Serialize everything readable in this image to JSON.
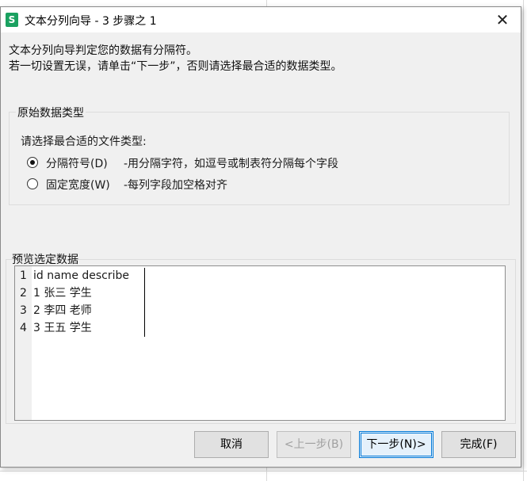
{
  "window": {
    "title": "文本分列向导 - 3 步骤之 1",
    "icon_letter": "S",
    "close_symbol": "✕"
  },
  "description": {
    "line1": "文本分列向导判定您的数据有分隔符。",
    "line2": "若一切设置无误，请单击“下一步”，否则请选择最合适的数据类型。"
  },
  "data_type_group": {
    "legend": "原始数据类型",
    "prompt": "请选择最合适的文件类型:",
    "options": [
      {
        "label": "分隔符号(D)",
        "hint": "-用分隔字符，如逗号或制表符分隔每个字段",
        "selected": true
      },
      {
        "label": "固定宽度(W)",
        "hint": "-每列字段加空格对齐",
        "selected": false
      }
    ]
  },
  "preview": {
    "legend": "预览选定数据",
    "rows": [
      {
        "num": "1",
        "text": "id name describe"
      },
      {
        "num": "2",
        "text": "1 张三 学生"
      },
      {
        "num": "3",
        "text": "2 李四 老师"
      },
      {
        "num": "4",
        "text": "3 王五 学生"
      }
    ]
  },
  "buttons": {
    "cancel": "取消",
    "back": "<上一步(B)",
    "next": "下一步(N)>",
    "finish": "完成(F)"
  },
  "colors": {
    "icon_green": "#1aa160",
    "dialog_bg": "#f0f0f0",
    "focus_blue": "#0078d7"
  }
}
